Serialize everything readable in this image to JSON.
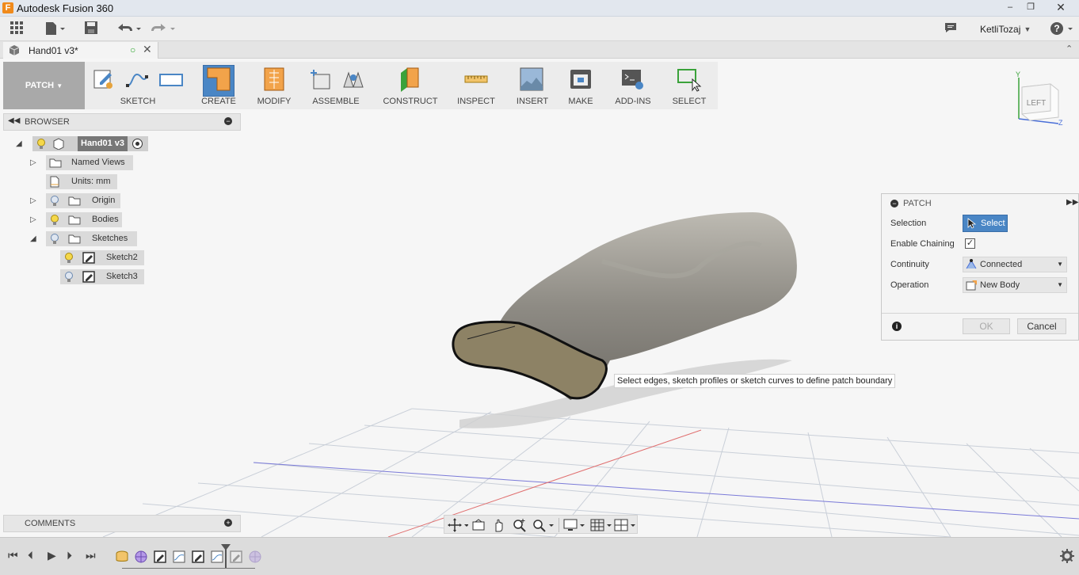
{
  "window": {
    "title": "Autodesk Fusion 360",
    "app_letter": "F"
  },
  "quickbar": {
    "user": "KetliTozaj"
  },
  "doc_tab": {
    "title": "Hand01 v3*"
  },
  "toolbar": {
    "workspace": "PATCH",
    "groups": [
      "SKETCH",
      "CREATE",
      "MODIFY",
      "ASSEMBLE",
      "CONSTRUCT",
      "INSPECT",
      "INSERT",
      "MAKE",
      "ADD-INS",
      "SELECT"
    ]
  },
  "browser": {
    "title": "BROWSER",
    "root": "Hand01 v3",
    "items": [
      {
        "label": "Named Views"
      },
      {
        "label": "Units: mm"
      },
      {
        "label": "Origin"
      },
      {
        "label": "Bodies"
      },
      {
        "label": "Sketches"
      },
      {
        "label": "Sketch2"
      },
      {
        "label": "Sketch3"
      }
    ]
  },
  "comments": {
    "title": "COMMENTS"
  },
  "patch_panel": {
    "title": "PATCH",
    "selection_label": "Selection",
    "select_button": "Select",
    "chaining_label": "Enable Chaining",
    "chaining_checked": true,
    "continuity_label": "Continuity",
    "continuity_value": "Connected",
    "operation_label": "Operation",
    "operation_value": "New Body",
    "ok": "OK",
    "cancel": "Cancel"
  },
  "hint": "Select edges, sketch profiles or sketch curves to define patch boundary",
  "viewcube": {
    "face": "LEFT",
    "axis_y": "Y",
    "axis_z": "Z"
  },
  "colors": {
    "accent": "#f08a1c",
    "select_blue": "#4a86c5",
    "workspace_gray": "#a9a9a9"
  }
}
